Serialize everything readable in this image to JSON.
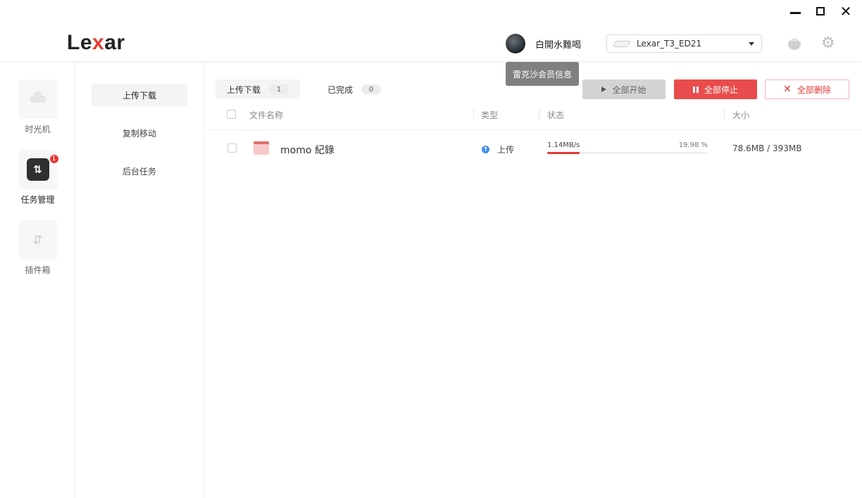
{
  "window": {
    "minimize": "—",
    "maximize": "□",
    "close": "✕"
  },
  "header": {
    "logo": {
      "before": "Le",
      "x": "x",
      "after": "ar"
    },
    "user": {
      "name": "白開水難喝",
      "tooltip": "雷克沙会员信息"
    },
    "device": {
      "selected": "Lexar_T3_ED21"
    }
  },
  "icons": {
    "chat": "chat-icon",
    "settings": "gear-icon",
    "time_machine": "cloud-icon",
    "task": "transfer-icon",
    "plugins": "sliders-icon"
  },
  "nav": {
    "items": [
      {
        "label": "时光机"
      },
      {
        "label": "任务管理",
        "badge": "1",
        "glyph": "⇅"
      },
      {
        "label": "插件箱"
      }
    ]
  },
  "subnav": {
    "items": [
      {
        "label": "上传下载"
      },
      {
        "label": "复制移动"
      },
      {
        "label": "后台任务"
      }
    ]
  },
  "main": {
    "tabs": [
      {
        "label": "上传下载",
        "count": "1"
      },
      {
        "label": "已完成",
        "count": "0"
      }
    ],
    "buttons": {
      "start_all": "全部开始",
      "stop_all": "全部停止",
      "delete_all": "全部删除"
    },
    "columns": {
      "name": "文件名称",
      "type": "类型",
      "status": "状态",
      "size": "大小"
    },
    "rows": [
      {
        "name": "momo 紀錄",
        "type": "上传",
        "speed": "1.14MB/s",
        "percent_text": "19.98 %",
        "progress": 19.98,
        "size": "78.6MB / 393MB"
      }
    ]
  },
  "colors": {
    "accent": "#e53935",
    "upload": "#3f8ef0"
  }
}
